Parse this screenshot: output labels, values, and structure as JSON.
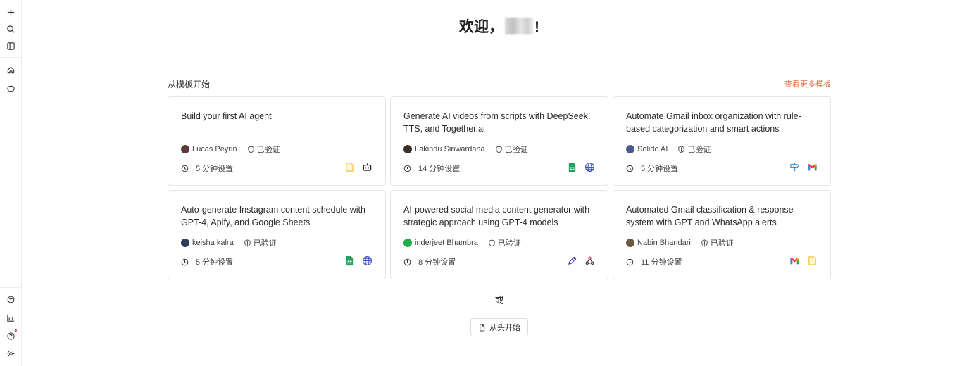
{
  "sidebar": {
    "top_icons": [
      "plus-icon",
      "search-icon",
      "panel-icon"
    ],
    "mid_icons": [
      "home-icon",
      "chat-icon"
    ],
    "bottom_icons": [
      "cube-icon",
      "bar-chart-icon",
      "help-icon",
      "settings-icon"
    ]
  },
  "welcome": {
    "prefix": "欢迎，",
    "suffix": "!"
  },
  "templates": {
    "section_label": "从模板开始",
    "more_label": "查看更多模板",
    "verified_label": "已验证",
    "cards": [
      {
        "title": "Build your first AI agent",
        "author": "Lucas Peyrin",
        "avatar_color": "#5b3b36",
        "setup": "5 分钟设置",
        "apps": [
          "note-icon",
          "robot-icon"
        ]
      },
      {
        "title": "Generate AI videos from scripts with DeepSeek, TTS, and Together.ai",
        "author": "Lakindu Siriwardana",
        "avatar_color": "#3a2f2a",
        "setup": "14 分钟设置",
        "apps": [
          "google-sheets-icon",
          "globe-icon"
        ]
      },
      {
        "title": "Automate Gmail inbox organization with rule-based categorization and smart actions",
        "author": "Solido AI",
        "avatar_color": "#4a5a8a",
        "setup": "5 分钟设置",
        "apps": [
          "signpost-icon",
          "gmail-icon"
        ]
      },
      {
        "title": "Auto-generate Instagram content schedule with GPT-4, Apify, and Google Sheets",
        "author": "keisha kalra",
        "avatar_color": "#2c3e5a",
        "setup": "5 分钟设置",
        "apps": [
          "google-sheets-icon",
          "globe-icon"
        ]
      },
      {
        "title": "AI-powered social media content generator with strategic approach using GPT-4 models",
        "author": "inderjeet Bhambra",
        "avatar_color": "#21b04b",
        "setup": "8 分钟设置",
        "apps": [
          "pencil-icon",
          "webhook-icon"
        ]
      },
      {
        "title": "Automated Gmail classification & response system with GPT and WhatsApp alerts",
        "author": "Nabin Bhandari",
        "avatar_color": "#6b5a40",
        "setup": "11 分钟设置",
        "apps": [
          "gmail-icon",
          "note-icon"
        ]
      }
    ]
  },
  "or_label": "或",
  "scratch_label": "从头开始"
}
